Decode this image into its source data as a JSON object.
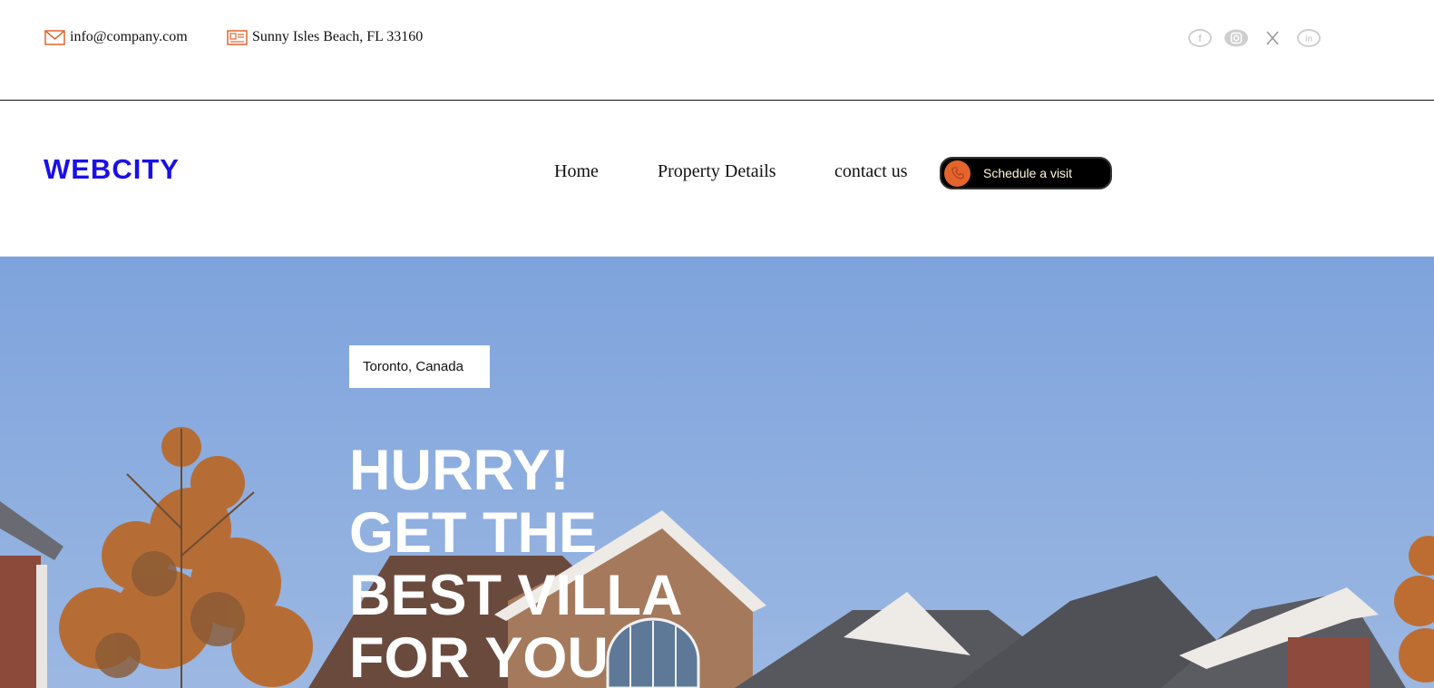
{
  "topbar": {
    "email": "info@company.com",
    "address": "Sunny Isles Beach, FL 33160",
    "icons": {
      "email": "envelope-icon",
      "address": "location-card-icon"
    },
    "socials": [
      "facebook-icon",
      "instagram-icon",
      "x-icon",
      "linkedin-icon"
    ]
  },
  "header": {
    "logo": "WEBCITY",
    "nav": [
      "Home",
      "Property Details",
      "contact us"
    ],
    "cta_label": "Schedule a visit",
    "cta_icon": "phone-icon"
  },
  "hero": {
    "location": "Toronto, Canada",
    "headline": [
      "HURRY!",
      "GET THE",
      "BEST VILLA",
      "FOR YOU"
    ]
  },
  "colors": {
    "brand": "#1a0fe8",
    "accent": "#e3652d",
    "cta_bg": "#000000",
    "sky": "#7ea3dc"
  }
}
